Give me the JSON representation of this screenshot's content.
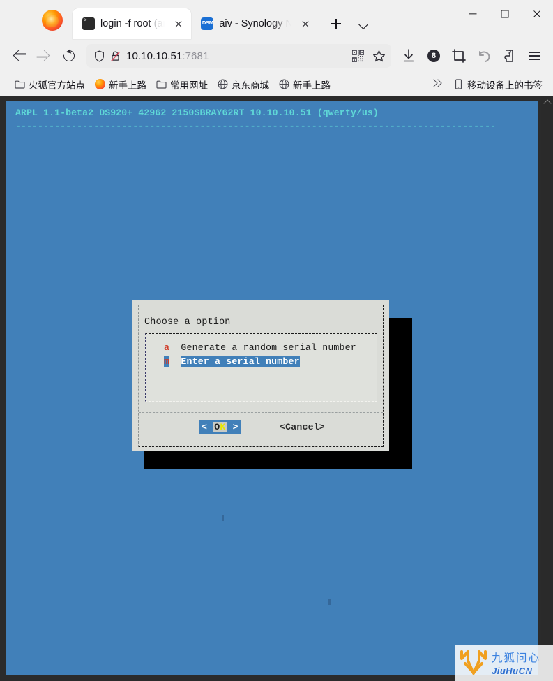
{
  "browser": {
    "logo_icon": "firefox-logo",
    "tabs": [
      {
        "title": "login -f root ",
        "title_dim": "(ar",
        "favicon": "terminal-icon",
        "active": true,
        "close_icon": "close-icon"
      },
      {
        "title": "aiv - Synology ",
        "title_dim": "N",
        "favicon": "dsm-icon",
        "active": false,
        "close_icon": "close-icon"
      }
    ],
    "new_tab_icon": "plus-icon",
    "tab_list_icon": "chevron-down-icon",
    "window_controls": {
      "minimize": "minimize-icon",
      "maximize": "maximize-icon",
      "close": "close-icon"
    },
    "nav": {
      "back_icon": "arrow-left-icon",
      "forward_icon": "arrow-right-icon",
      "reload_icon": "reload-icon"
    },
    "urlbar": {
      "shield_icon": "shield-icon",
      "security_icon": "lock-crossed-out-icon",
      "host": "10.10.10.51",
      "port": ":7681",
      "qr_icon": "qr-code-icon",
      "bookmark_icon": "star-icon"
    },
    "toolbar": {
      "download_icon": "download-icon",
      "counter_badge": "8",
      "screenshot_icon": "crop-icon",
      "undo_icon": "undo-arrow-icon",
      "extensions_icon": "puzzle-piece-icon",
      "menu_icon": "hamburger-menu-icon"
    },
    "bookmarks": {
      "items": [
        {
          "label": "火狐官方站点",
          "icon": "folder-icon"
        },
        {
          "label": "新手上路",
          "icon": "firefox-icon"
        },
        {
          "label": "常用网址",
          "icon": "folder-icon"
        },
        {
          "label": "京东商城",
          "icon": "globe-icon"
        },
        {
          "label": "新手上路",
          "icon": "globe-icon"
        }
      ],
      "overflow_icon": "double-chevron-right-icon",
      "mobile": {
        "label": "移动设备上的书签",
        "icon": "mobile-device-icon"
      }
    }
  },
  "terminal": {
    "header": "ARPL 1.1-beta2 DS920+ 42962 2150SBRAY62RT 10.10.10.51 (qwerty/us)",
    "rule": "--------------------------------------------------------------------------------------",
    "bg_color": "#4180b9",
    "header_color": "#5fd7d7"
  },
  "dialog": {
    "title": "Choose a option",
    "options": [
      {
        "key": "a",
        "label": "Generate a random serial number",
        "selected": false
      },
      {
        "key": "m",
        "label": "Enter a serial number",
        "selected": true
      }
    ],
    "buttons": {
      "ok": {
        "left_bracket": "<",
        "text_o": "O",
        "text_k": "K",
        "right_bracket": ">",
        "focused": true
      },
      "cancel": "<Cancel>"
    },
    "accent_color": "#4180b9",
    "key_color": "#d03b28",
    "bg_color": "#dadcd7"
  },
  "scrollbar": {
    "up_arrow_icon": "chevron-up-icon"
  },
  "watermark": {
    "logo_icon": "fox-m-logo",
    "text_cn": "九狐问心",
    "text_en": "JiuHuCN",
    "logo_color": "#f0a020",
    "text_color": "#3b82e0"
  }
}
